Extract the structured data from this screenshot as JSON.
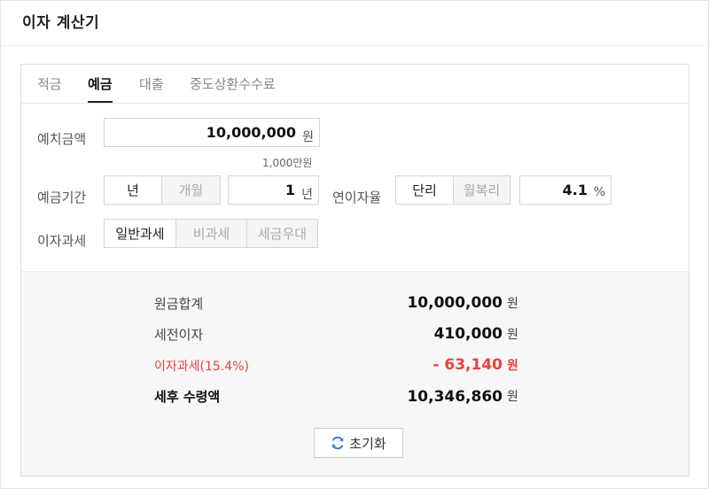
{
  "app": {
    "title": "이자 계산기"
  },
  "tabs": [
    {
      "label": "적금",
      "active": false
    },
    {
      "label": "예금",
      "active": true
    },
    {
      "label": "대출",
      "active": false
    },
    {
      "label": "중도상환수수료",
      "active": false
    }
  ],
  "deposit": {
    "label": "예치금액",
    "value": "10,000,000",
    "unit": "원",
    "hint": "1,000만원"
  },
  "period": {
    "label": "예금기간",
    "options": [
      {
        "label": "년",
        "selected": true
      },
      {
        "label": "개월",
        "selected": false
      }
    ],
    "value": "1",
    "unit": "년"
  },
  "rate": {
    "label": "연이자율",
    "options": [
      {
        "label": "단리",
        "selected": true
      },
      {
        "label": "월복리",
        "selected": false
      }
    ],
    "value": "4.1",
    "unit": "%"
  },
  "tax": {
    "label": "이자과세",
    "options": [
      {
        "label": "일반과세",
        "selected": true
      },
      {
        "label": "비과세",
        "selected": false
      },
      {
        "label": "세금우대",
        "selected": false
      }
    ]
  },
  "results": {
    "principal": {
      "label": "원금합계",
      "value": "10,000,000",
      "unit": "원"
    },
    "pretax_interest": {
      "label": "세전이자",
      "value": "410,000",
      "unit": "원"
    },
    "tax": {
      "label": "이자과세(15.4%)",
      "value": "- 63,140",
      "unit": "원"
    },
    "net": {
      "label": "세후 수령액",
      "value": "10,346,860",
      "unit": "원"
    }
  },
  "reset": {
    "label": "초기화",
    "icon": "refresh-icon"
  },
  "colors": {
    "accent_red": "#e8413d",
    "refresh_blue": "#3d7be0"
  }
}
